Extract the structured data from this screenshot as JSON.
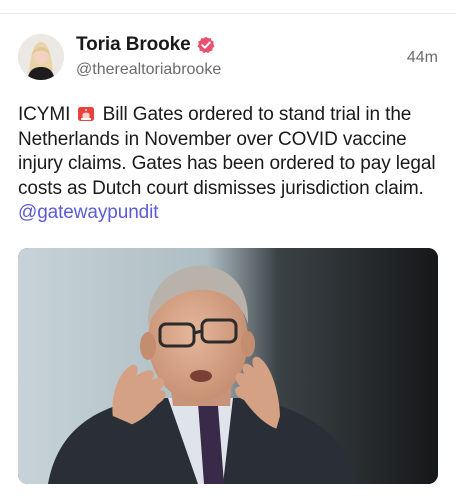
{
  "post": {
    "author": {
      "display_name": "Toria Brooke",
      "handle": "@therealtoriabrooke",
      "verified": true
    },
    "timestamp": "44m",
    "text": {
      "prefix": "ICYMI",
      "emoji": "siren-icon",
      "body": " Bill Gates ordered to stand trial in the Netherlands in November over COVID vaccine injury claims. Gates has been ordered to pay legal costs as Dutch court dismisses jurisdiction claim. ",
      "mention": "@gatewaypundit"
    },
    "media": {
      "type": "photo"
    }
  },
  "colors": {
    "mention": "#5b5bd6",
    "verified_badge": "#e8526f",
    "secondary_text": "#6b6b6b"
  }
}
